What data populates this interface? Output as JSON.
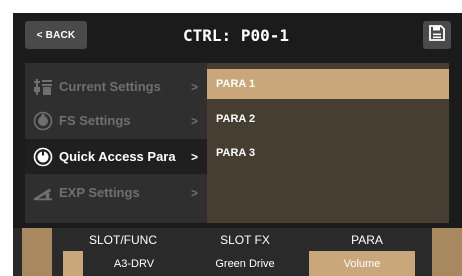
{
  "header": {
    "back_label": "< BACK",
    "title": "CTRL: P00-1",
    "save_icon": "save-icon"
  },
  "menu": {
    "items": [
      {
        "label": "Current Settings",
        "arrow": ">",
        "icon": "settings-icon",
        "state": "dim"
      },
      {
        "label": "FS Settings",
        "arrow": ">",
        "icon": "footswitch-icon",
        "state": "dim"
      },
      {
        "label": "Quick Access Para",
        "arrow": ">",
        "icon": "knob-icon",
        "state": "active"
      },
      {
        "label": "EXP Settings",
        "arrow": ">",
        "icon": "pedal-icon",
        "state": "dim"
      }
    ]
  },
  "list": {
    "items": [
      {
        "label": "PARA 1",
        "selected": true
      },
      {
        "label": "PARA 2",
        "selected": false
      },
      {
        "label": "PARA 3",
        "selected": false
      }
    ]
  },
  "bottom": {
    "columns": [
      {
        "title": "SLOT/FUNC",
        "value": "A3-DRV"
      },
      {
        "title": "SLOT FX",
        "value": "Green Drive"
      },
      {
        "title": "PARA",
        "value": "Volume"
      }
    ]
  },
  "colors": {
    "background": "#1b1b1b",
    "panel": "#2f2f2f",
    "list_bg": "#463e31",
    "accent": "#c9a77a",
    "button": "#4a4a4a"
  }
}
